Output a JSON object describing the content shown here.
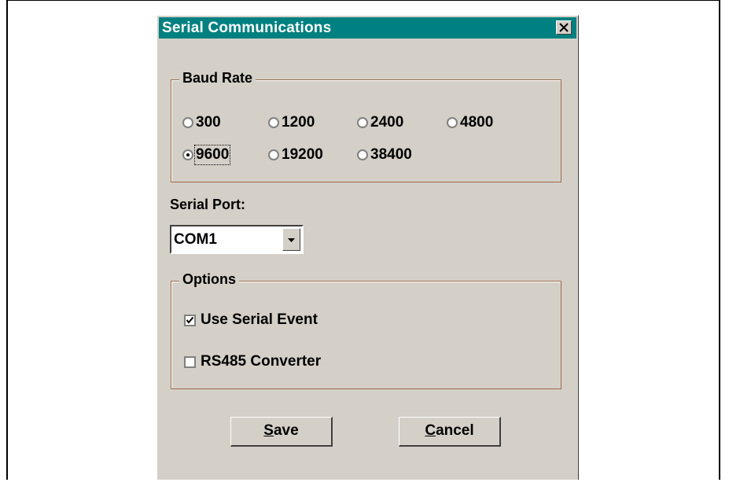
{
  "window": {
    "title": "Serial Communications"
  },
  "icons": {
    "close": "close-icon",
    "dropdown": "chevron-down-icon",
    "check": "check-icon"
  },
  "baud_rate": {
    "legend": "Baud Rate",
    "options": [
      "300",
      "1200",
      "2400",
      "4800",
      "9600",
      "19200",
      "38400"
    ],
    "selected": "9600"
  },
  "serial_port": {
    "label": "Serial Port:",
    "value": "COM1"
  },
  "options_group": {
    "legend": "Options",
    "use_serial_event": {
      "label": "Use Serial Event",
      "checked": true
    },
    "rs485_converter": {
      "label": "RS485 Converter",
      "checked": false
    }
  },
  "buttons": {
    "save": {
      "mnemonic": "S",
      "rest": "ave"
    },
    "cancel": {
      "mnemonic": "C",
      "rest": "ancel"
    }
  },
  "colors": {
    "titlebar": "#008080",
    "face": "#d4d0c8",
    "group_border": "#9c6a4a"
  }
}
